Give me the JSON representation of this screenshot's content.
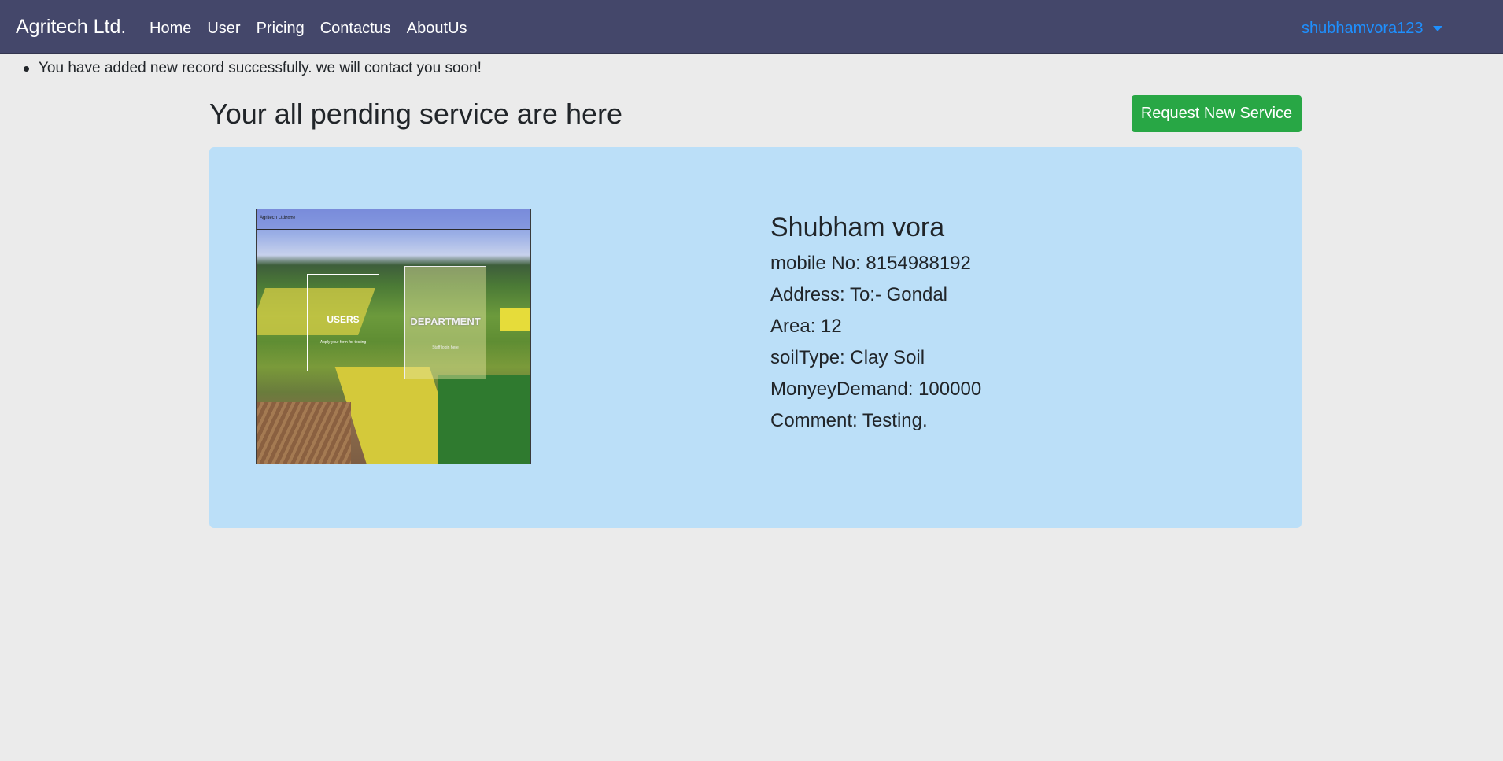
{
  "navbar": {
    "brand": "Agritech Ltd.",
    "links": [
      "Home",
      "User",
      "Pricing",
      "Contactus",
      "AboutUs"
    ],
    "user": "shubhamvora123"
  },
  "flash": {
    "message": "You have added new record successfully. we will contact you soon!"
  },
  "header": {
    "title": "Your all pending service are here",
    "request_button": "Request New Service"
  },
  "service": {
    "thumbnail": {
      "brand": "Agritech Ltd.",
      "nav": "Home",
      "users_title": "USERS",
      "users_subtitle": "Apply your form for testing",
      "department_title": "DEPARTMENT",
      "department_subtitle": "Staff login here"
    },
    "name": "Shubham vora",
    "mobile": "mobile No: 8154988192",
    "address": "Address: To:- Gondal",
    "area": "Area: 12",
    "soil_type": "soilType: Clay Soil",
    "money_demand": "MonyeyDemand: 100000",
    "comment": "Comment: Testing."
  },
  "colors": {
    "navbar": "#44476a",
    "card": "#bbdff8",
    "success": "#28a745",
    "link": "#1e90ff",
    "page_bg": "#ebebeb"
  }
}
